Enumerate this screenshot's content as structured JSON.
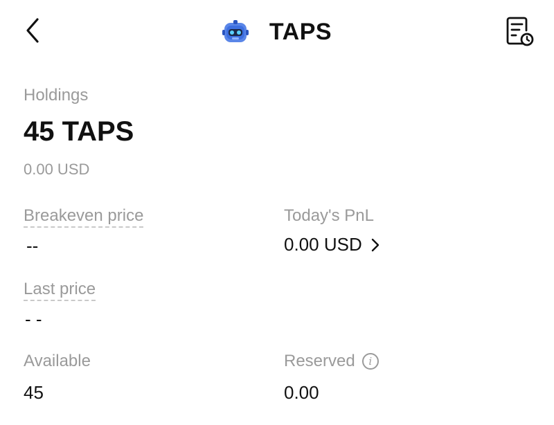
{
  "header": {
    "back_icon": "chevron-left-icon",
    "logo_icon": "robot-token-logo",
    "title": "TAPS",
    "history_icon": "document-clock-icon"
  },
  "holdings": {
    "label": "Holdings",
    "amount": "45 TAPS",
    "usd_value": "0.00 USD"
  },
  "stats": {
    "breakeven_label": "Breakeven price",
    "breakeven_value": "--",
    "pnl_label": "Today's PnL",
    "pnl_value": "0.00 USD",
    "last_price_label": "Last price",
    "last_price_value": "- -",
    "available_label": "Available",
    "available_value": "45",
    "reserved_label": "Reserved",
    "reserved_value": "0.00"
  },
  "colors": {
    "text": "#111111",
    "muted": "#9a9a9a",
    "logo_blue": "#3d6fe0"
  }
}
